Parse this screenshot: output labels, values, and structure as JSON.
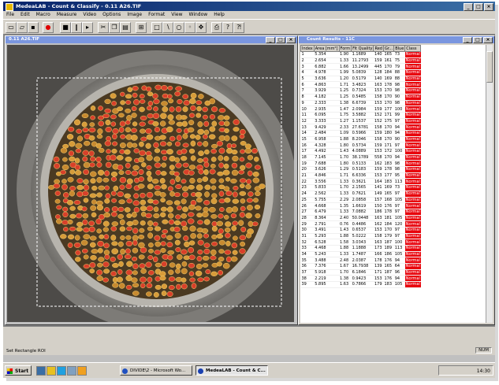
{
  "window": {
    "title": "MedeaLAB - Count & Classify - 0.11 A26.TIF"
  },
  "menu": [
    "File",
    "Edit",
    "Macro",
    "Measure",
    "Video",
    "Options",
    "Image",
    "Format",
    "View",
    "Window",
    "Help"
  ],
  "image_window": {
    "title": "0.11 A26.TIF"
  },
  "results_window": {
    "title": "Count Results - 11C",
    "columns": [
      "Index",
      "Area [mm²]",
      "Form",
      "Fit Quality",
      "Red",
      "Gr...",
      "Blue",
      "Class"
    ],
    "rows": [
      [
        "1",
        "5.354",
        "1.90",
        "1.1689",
        "140",
        "165",
        "73",
        "Normal"
      ],
      [
        "2",
        "2.654",
        "1.33",
        "11.2793",
        "159",
        "161",
        "75",
        "Normal"
      ],
      [
        "3",
        "6.882",
        "1.66",
        "13.2499",
        "445",
        "170",
        "79",
        "Normal"
      ],
      [
        "4",
        "4.978",
        "1.99",
        "5.0839",
        "128",
        "184",
        "88",
        "Normal"
      ],
      [
        "5",
        "3.636",
        "1.20",
        "0.5179",
        "140",
        "169",
        "88",
        "Normal"
      ],
      [
        "6",
        "4.863",
        "1.71",
        "3.4823",
        "163",
        "178",
        "98",
        "Normal"
      ],
      [
        "7",
        "3.929",
        "1.25",
        "0.7324",
        "153",
        "170",
        "98",
        "Normal"
      ],
      [
        "8",
        "4.182",
        "1.25",
        "0.5485",
        "158",
        "170",
        "90",
        "Normal"
      ],
      [
        "9",
        "2.333",
        "1.38",
        "6.6739",
        "153",
        "170",
        "98",
        "Normal"
      ],
      [
        "10",
        "2.935",
        "1.47",
        "2.0984",
        "159",
        "177",
        "100",
        "Normal"
      ],
      [
        "11",
        "6.095",
        "1.75",
        "3.5882",
        "152",
        "171",
        "99",
        "Normal"
      ],
      [
        "12",
        "3.333",
        "1.27",
        "1.1537",
        "152",
        "175",
        "97",
        "Normal"
      ],
      [
        "13",
        "9.429",
        "2.33",
        "27.6781",
        "158",
        "170",
        "94",
        "Normal"
      ],
      [
        "14",
        "2.484",
        "1.09",
        "0.5966",
        "159",
        "180",
        "94",
        "Normal"
      ],
      [
        "15",
        "6.958",
        "1.88",
        "8.2046",
        "158",
        "170",
        "90",
        "Normal"
      ],
      [
        "16",
        "4.328",
        "1.80",
        "0.5734",
        "159",
        "171",
        "97",
        "Normal"
      ],
      [
        "17",
        "4.492",
        "1.43",
        "4.0889",
        "153",
        "172",
        "100",
        "Normal"
      ],
      [
        "18",
        "7.145",
        "1.70",
        "38.1789",
        "558",
        "170",
        "94",
        "Normal"
      ],
      [
        "19",
        "7.688",
        "1.80",
        "0.5133",
        "162",
        "183",
        "98",
        "Normal"
      ],
      [
        "20",
        "3.626",
        "1.29",
        "0.5183",
        "159",
        "178",
        "98",
        "Normal"
      ],
      [
        "21",
        "4.846",
        "1.71",
        "6.6336",
        "153",
        "177",
        "95",
        "Normal"
      ],
      [
        "22",
        "3.556",
        "1.33",
        "0.3621",
        "164",
        "183",
        "113",
        "Normal"
      ],
      [
        "23",
        "5.833",
        "1.70",
        "2.1565",
        "141",
        "169",
        "73",
        "Normal"
      ],
      [
        "24",
        "2.562",
        "1.33",
        "0.7621",
        "149",
        "165",
        "97",
        "Normal"
      ],
      [
        "25",
        "5.755",
        "2.29",
        "2.0858",
        "157",
        "168",
        "105",
        "Normal"
      ],
      [
        "26",
        "4.668",
        "1.35",
        "1.6619",
        "150",
        "176",
        "97",
        "Normal"
      ],
      [
        "27",
        "6.479",
        "1.33",
        "7.0882",
        "186",
        "178",
        "97",
        "Normal"
      ],
      [
        "28",
        "8.364",
        "2.40",
        "50.0448",
        "163",
        "181",
        "105",
        "Normal"
      ],
      [
        "29",
        "2.791",
        "0.76",
        "0.4486",
        "162",
        "184",
        "120",
        "Normal"
      ],
      [
        "30",
        "3.491",
        "1.43",
        "0.6537",
        "153",
        "170",
        "97",
        "Normal"
      ],
      [
        "31",
        "5.293",
        "1.88",
        "5.0222",
        "158",
        "179",
        "97",
        "Normal"
      ],
      [
        "32",
        "6.528",
        "1.58",
        "3.0343",
        "163",
        "187",
        "100",
        "Normal"
      ],
      [
        "33",
        "4.468",
        "1.88",
        "1.1888",
        "173",
        "189",
        "113",
        "Normal"
      ],
      [
        "34",
        "5.243",
        "1.33",
        "1.7487",
        "166",
        "186",
        "105",
        "Normal"
      ],
      [
        "35",
        "3.488",
        "2.48",
        "2.0387",
        "178",
        "176",
        "94",
        "Normal"
      ],
      [
        "36",
        "7.376",
        "1.67",
        "16.7938",
        "139",
        "165",
        "64",
        "Normal"
      ],
      [
        "37",
        "5.918",
        "1.70",
        "6.1846",
        "171",
        "187",
        "96",
        "Normal"
      ],
      [
        "38",
        "2.219",
        "1.38",
        "0.9423",
        "153",
        "176",
        "94",
        "Normal"
      ],
      [
        "39",
        "5.895",
        "1.63",
        "0.7866",
        "179",
        "183",
        "105",
        "Normal"
      ]
    ]
  },
  "status": {
    "message": "Set Rectangle ROI",
    "indicator": "NUM"
  },
  "taskbar": {
    "start": "Start",
    "tasks": [
      {
        "label": "DIVIDE\\2 - Microsoft Wo...",
        "active": false,
        "color": "#2050c0"
      },
      {
        "label": "MedeaLAB - Count & C...",
        "active": true,
        "color": "#1a40b0"
      }
    ],
    "clock": "14:30"
  }
}
